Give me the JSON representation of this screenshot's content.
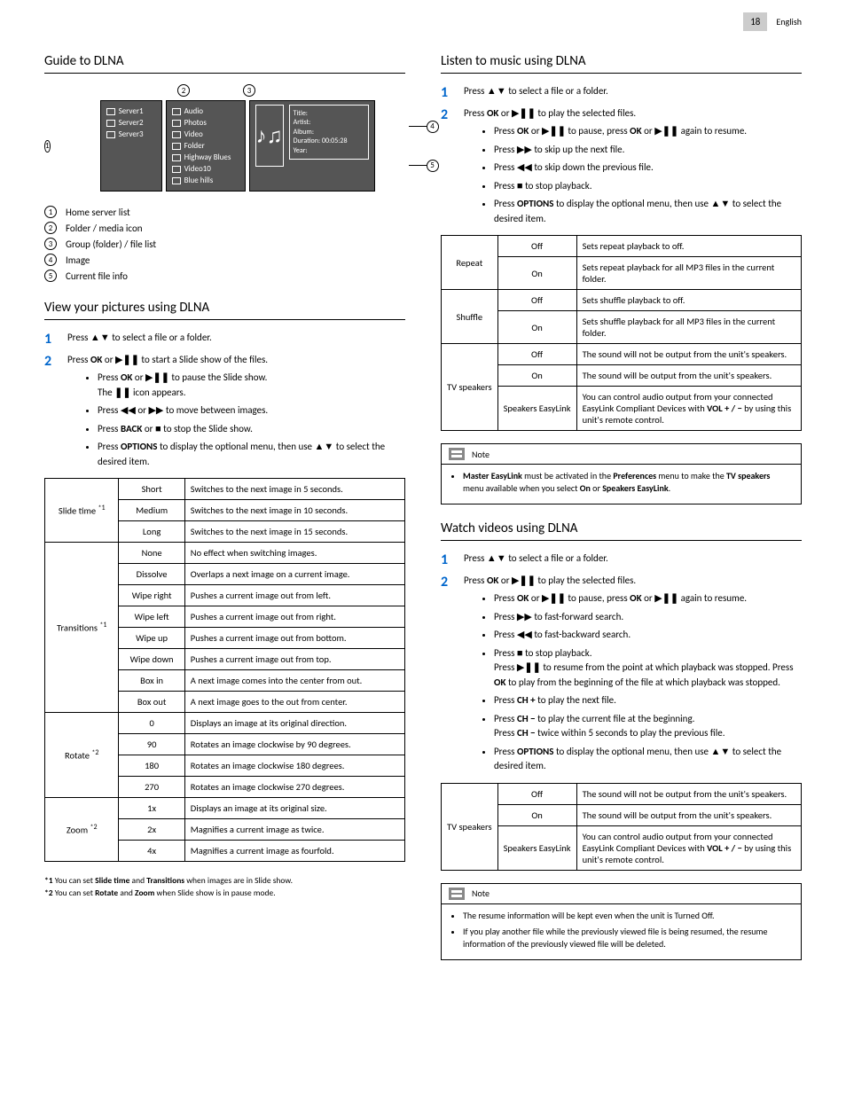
{
  "page": {
    "num": "18",
    "lang": "English"
  },
  "left": {
    "h_guide": "Guide to DLNA",
    "diagram": {
      "servers": [
        "Server1",
        "Server2",
        "Server3"
      ],
      "media": [
        "Audio",
        "Photos",
        "Video",
        "Folder",
        "Highway Blues",
        "Video10",
        "Blue hills"
      ],
      "meta": {
        "title": "Title:",
        "artist": "Artist:",
        "album": "Album:",
        "duration": "Duration: 00:05:28",
        "year": "Year:"
      }
    },
    "legend": [
      {
        "n": "1",
        "t": "Home server list"
      },
      {
        "n": "2",
        "t": "Folder / media icon"
      },
      {
        "n": "3",
        "t": "Group (folder) / file list"
      },
      {
        "n": "4",
        "t": "Image"
      },
      {
        "n": "5",
        "t": "Current file info"
      }
    ],
    "h_view": "View your pictures using DLNA",
    "view_s1": "Press ▲▼ to select a file or a folder.",
    "view_s2_a": "Press ",
    "view_s2_b": " or ▶",
    "view_s2_c": " to start a Slide show of the files.",
    "view_b1a": "Press ",
    "view_b1b": " or ▶",
    "view_b1c": " to pause the Slide show.",
    "view_b1d": "The ",
    "view_b1e": " icon appears.",
    "view_b2": "Press ◀◀ or ▶▶ to move between images.",
    "view_b3a": "Press ",
    "view_b3b": " or ■ to stop the Slide show.",
    "view_b4a": "Press ",
    "view_b4b": " to display the optional menu, then use ▲▼ to select the desired item.",
    "tbl_pics": {
      "slide": {
        "label": "Slide time",
        "note": "*1",
        "rows": [
          {
            "v": "Short",
            "d": "Switches to the next image in 5 seconds."
          },
          {
            "v": "Medium",
            "d": "Switches to the next image in 10 seconds."
          },
          {
            "v": "Long",
            "d": "Switches to the next image in 15 seconds."
          }
        ]
      },
      "trans": {
        "label": "Transitions",
        "note": "*1",
        "rows": [
          {
            "v": "None",
            "d": "No effect when switching images."
          },
          {
            "v": "Dissolve",
            "d": "Overlaps a next image on a current image."
          },
          {
            "v": "Wipe right",
            "d": "Pushes a current image out from left."
          },
          {
            "v": "Wipe left",
            "d": "Pushes a current image out from right."
          },
          {
            "v": "Wipe up",
            "d": "Pushes a current image out from bottom."
          },
          {
            "v": "Wipe down",
            "d": "Pushes a current image out from top."
          },
          {
            "v": "Box in",
            "d": "A next image comes into the center from out."
          },
          {
            "v": "Box out",
            "d": "A next image goes to the out from center."
          }
        ]
      },
      "rotate": {
        "label": "Rotate",
        "note": "*2",
        "rows": [
          {
            "v": "0",
            "d": "Displays an image at its original direction."
          },
          {
            "v": "90",
            "d": "Rotates an image clockwise by 90 degrees."
          },
          {
            "v": "180",
            "d": "Rotates an image clockwise 180 degrees."
          },
          {
            "v": "270",
            "d": "Rotates an image clockwise 270 degrees."
          }
        ]
      },
      "zoom": {
        "label": "Zoom",
        "note": "*2",
        "rows": [
          {
            "v": "1x",
            "d": "Displays an image at its original size."
          },
          {
            "v": "2x",
            "d": "Magnifies a current image as twice."
          },
          {
            "v": "4x",
            "d": "Magnifies a current image as fourfold."
          }
        ]
      }
    },
    "fn1a": "*1",
    "fn1b": "You can set ",
    "fn1c": " and ",
    "fn1d": " when images are in Slide show.",
    "fn1k1": "Slide time",
    "fn1k2": "Transitions",
    "fn2a": "*2",
    "fn2b": "You can set ",
    "fn2c": " and ",
    "fn2d": " when Slide show is in pause mode.",
    "fn2k1": "Rotate",
    "fn2k2": "Zoom"
  },
  "right": {
    "h_music": "Listen to music using DLNA",
    "m_s1": "Press ▲▼ to select a file or a folder.",
    "m_s2a": "Press ",
    "m_s2b": " or ▶",
    "m_s2c": " to play the selected files.",
    "m_b1a": "Press ",
    "m_b1b": " or ▶",
    "m_b1c": " to pause, press ",
    "m_b1d": " or ▶",
    "m_b1e": " again to resume.",
    "m_b2": "Press ▶▶ to skip up the next file.",
    "m_b3": "Press ◀◀ to skip down the previous file.",
    "m_b4": "Press ■ to stop playback.",
    "m_b5a": "Press ",
    "m_b5b": " to display the optional menu, then use ▲▼ to select the desired item.",
    "tbl_music": {
      "repeat": {
        "label": "Repeat",
        "rows": [
          {
            "v": "Off",
            "d": "Sets repeat playback to off."
          },
          {
            "v": "On",
            "d": "Sets repeat playback for all MP3 files in the current folder."
          }
        ]
      },
      "shuffle": {
        "label": "Shuffle",
        "rows": [
          {
            "v": "Off",
            "d": "Sets shuffle playback to off."
          },
          {
            "v": "On",
            "d": "Sets shuffle playback for all MP3 files in the current folder."
          }
        ]
      },
      "tvsp": {
        "label": "TV speakers",
        "rows": [
          {
            "v": "Off",
            "d": "The sound will not be output from the unit's speakers."
          },
          {
            "v": "On",
            "d": "The sound will be output from the unit's speakers."
          },
          {
            "v": "Speakers EasyLink",
            "d_a": "You can control audio output from your connected EasyLink Compliant Devices with ",
            "d_b": " by using this unit's remote control.",
            "d_k": "VOL + / −"
          }
        ]
      }
    },
    "note1_hdr": "Note",
    "note1_a": "Master EasyLink",
    "note1_b": " must be activated in the ",
    "note1_c": "Preferences",
    "note1_d": " menu to make the ",
    "note1_e": "TV speakers",
    "note1_f": " menu available when you select ",
    "note1_g": "On",
    "note1_h": " or ",
    "note1_i": "Speakers EasyLink",
    "note1_j": ".",
    "h_video": "Watch videos using DLNA",
    "v_s1": "Press ▲▼ to select a file or a folder.",
    "v_s2a": "Press ",
    "v_s2b": " or ▶",
    "v_s2c": " to play the selected files.",
    "v_b1a": "Press ",
    "v_b1b": " or ▶",
    "v_b1c": " to pause, press ",
    "v_b1d": " or ▶",
    "v_b1e": " again to resume.",
    "v_b2": "Press ▶▶ to fast-forward search.",
    "v_b3": "Press ◀◀ to fast-backward search.",
    "v_b4": "Press ■ to stop playback.",
    "v_b4b_a": "Press ▶",
    "v_b4b_b": " to resume from the point at which playback was stopped. Press ",
    "v_b4b_c": " to play from the beginning of the file at which playback was stopped.",
    "v_b5a": "Press ",
    "v_b5b": " to play the next file.",
    "v_b5k": "CH +",
    "v_b6a": "Press ",
    "v_b6b": " to play the current file at the beginning.",
    "v_b6k": "CH −",
    "v_b6c": "Press ",
    "v_b6d": " twice within 5 seconds to play the previous file.",
    "v_b6k2": "CH −",
    "v_b7a": "Press ",
    "v_b7b": " to display the optional menu, then use ▲▼ to select the desired item.",
    "tbl_video": {
      "tvsp": {
        "label": "TV speakers",
        "rows": [
          {
            "v": "Off",
            "d": "The sound will not be output from the unit's speakers."
          },
          {
            "v": "On",
            "d": "The sound will be output from the unit's speakers."
          },
          {
            "v": "Speakers EasyLink",
            "d_a": "You can control audio output from your connected EasyLink Compliant Devices with ",
            "d_b": " by using this unit's remote control.",
            "d_k": "VOL + / −"
          }
        ]
      }
    },
    "note2_hdr": "Note",
    "note2_l1": "The resume information will be kept even when the unit is Turned Off.",
    "note2_l2": "If you play another file while the previously viewed file is being resumed, the resume information of the previously viewed file will be deleted."
  },
  "keys": {
    "OK": "OK",
    "BACK": "BACK",
    "OPTIONS": "OPTIONS",
    "PAUSE": "❚❚",
    "PLAYPAUSE": "❚❚"
  }
}
